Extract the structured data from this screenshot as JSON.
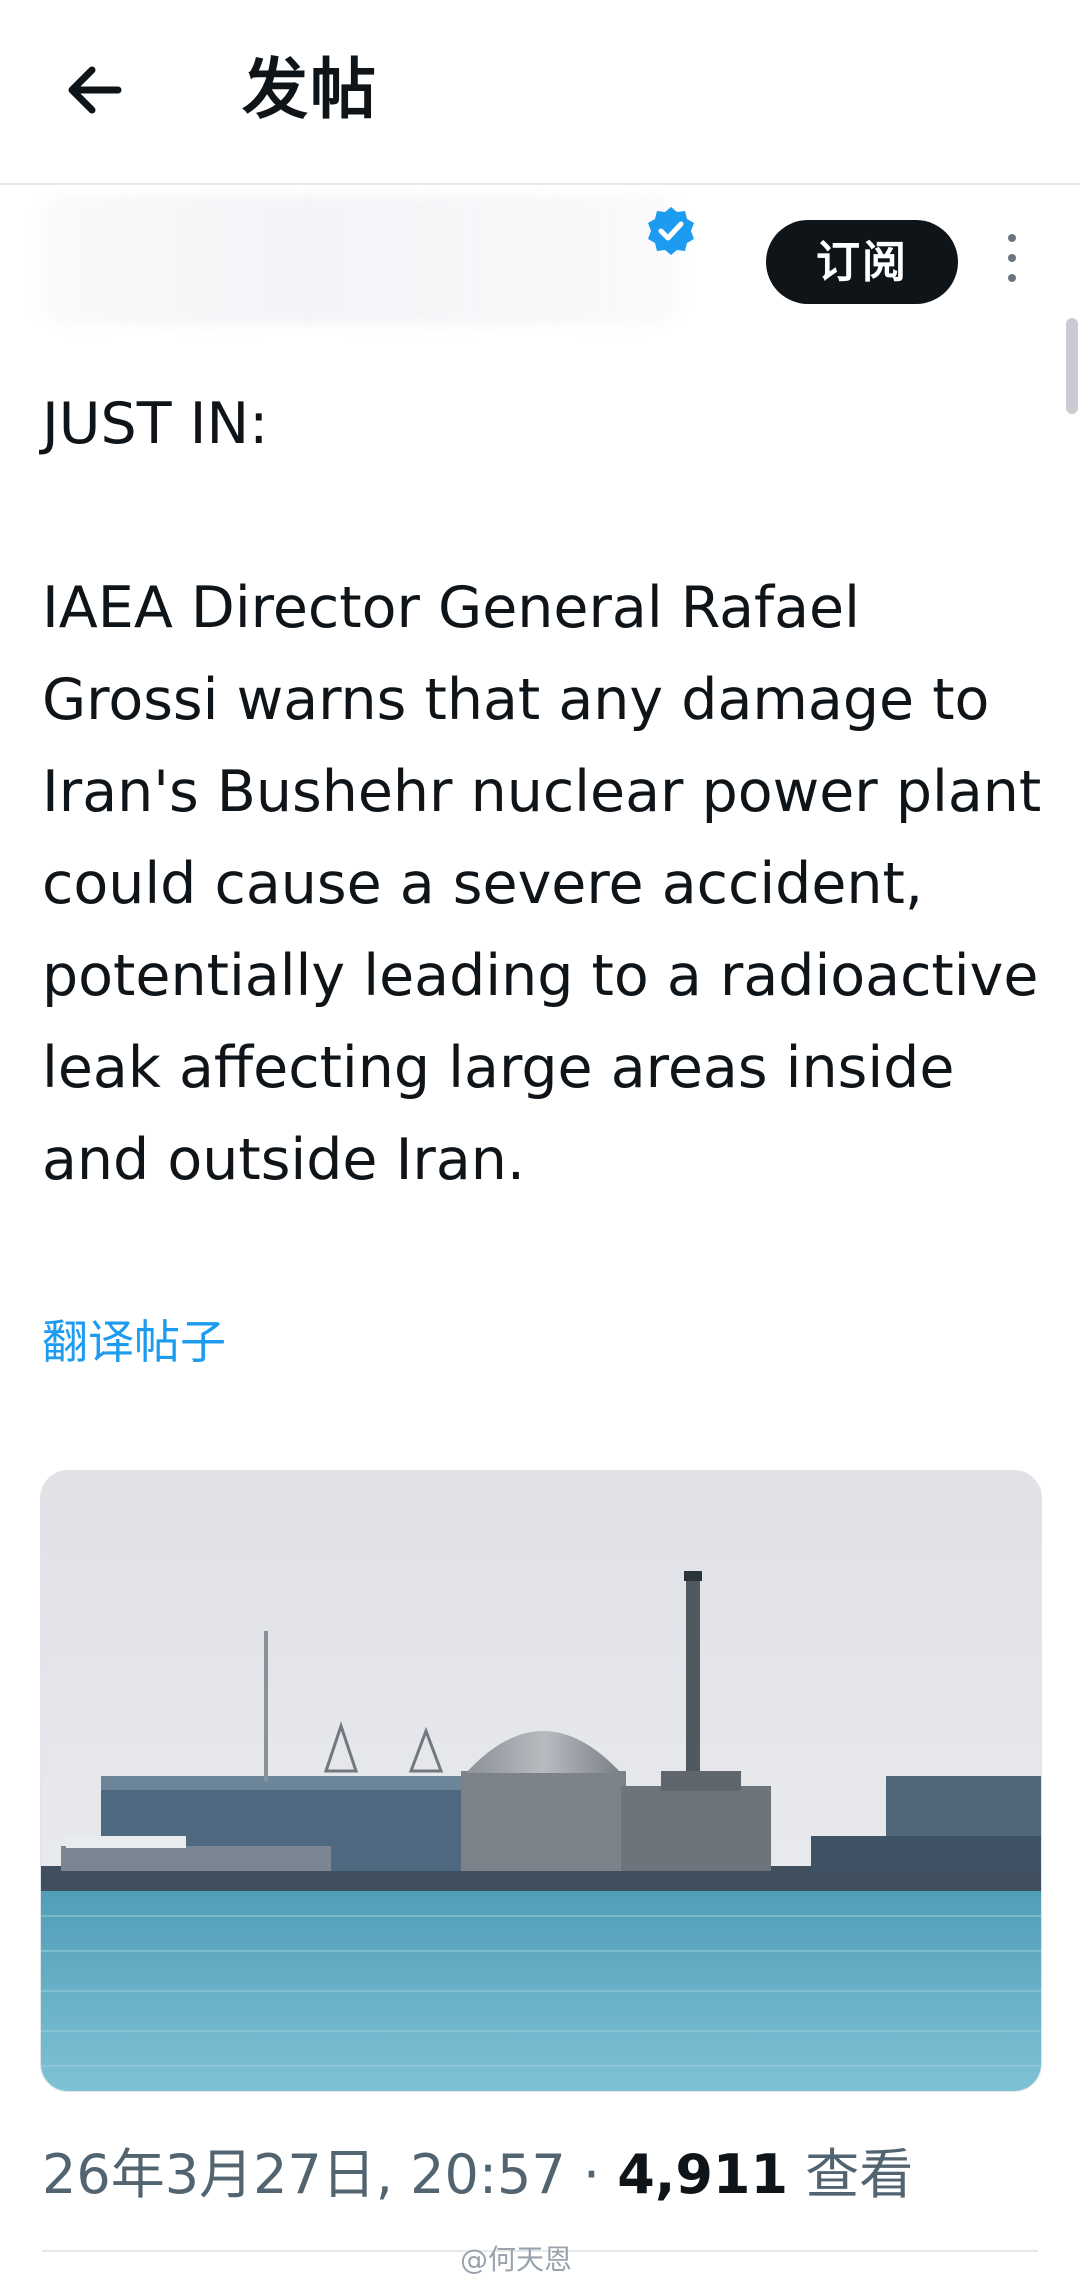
{
  "header": {
    "title": "发帖"
  },
  "author": {
    "subscribe_label": "订阅"
  },
  "tweet": {
    "heading": "JUST IN:",
    "body": "IAEA Director General Rafael Grossi warns that any damage to Iran's Bushehr nuclear power plant could cause a severe accident, potentially leading to a radioactive leak affecting large areas inside and outside Iran.",
    "translate_label": "翻译帖子"
  },
  "meta": {
    "timestamp": "26年3月27日, 20:57",
    "separator": "·",
    "views_count": "4,911",
    "views_label": "查看"
  },
  "watermark": "@何天恩",
  "colors": {
    "link": "#1d9bf0",
    "verified": "#1d9bf0",
    "button_bg": "#0f1419",
    "muted": "#536471"
  },
  "icons": {
    "back": "arrow-left-icon",
    "verified": "verified-badge-icon",
    "more": "more-vertical-icon"
  }
}
